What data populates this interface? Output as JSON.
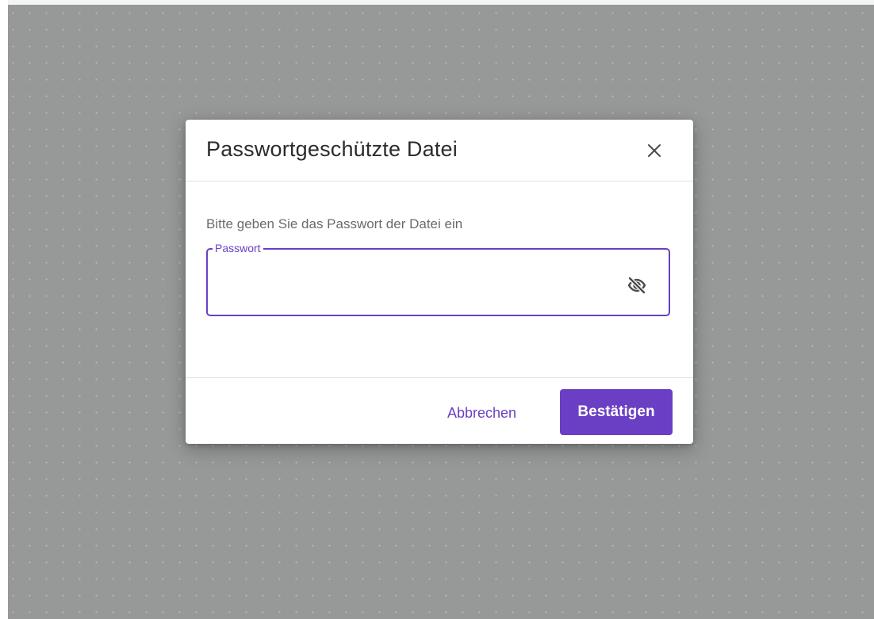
{
  "dialog": {
    "title": "Passwortgeschützte Datei",
    "close_icon": "close-icon",
    "instruction": "Bitte geben Sie das Passwort der Datei ein",
    "password_field": {
      "label": "Passwort",
      "value": "",
      "toggle_icon": "eye-off-icon"
    },
    "cancel_label": "Abbrechen",
    "confirm_label": "Bestätigen"
  },
  "colors": {
    "accent": "#6a3fc4",
    "backdrop": "#979998",
    "dialog_background": "#ffffff",
    "title_text": "#2c2c2c",
    "body_text": "#6a6a6a"
  }
}
